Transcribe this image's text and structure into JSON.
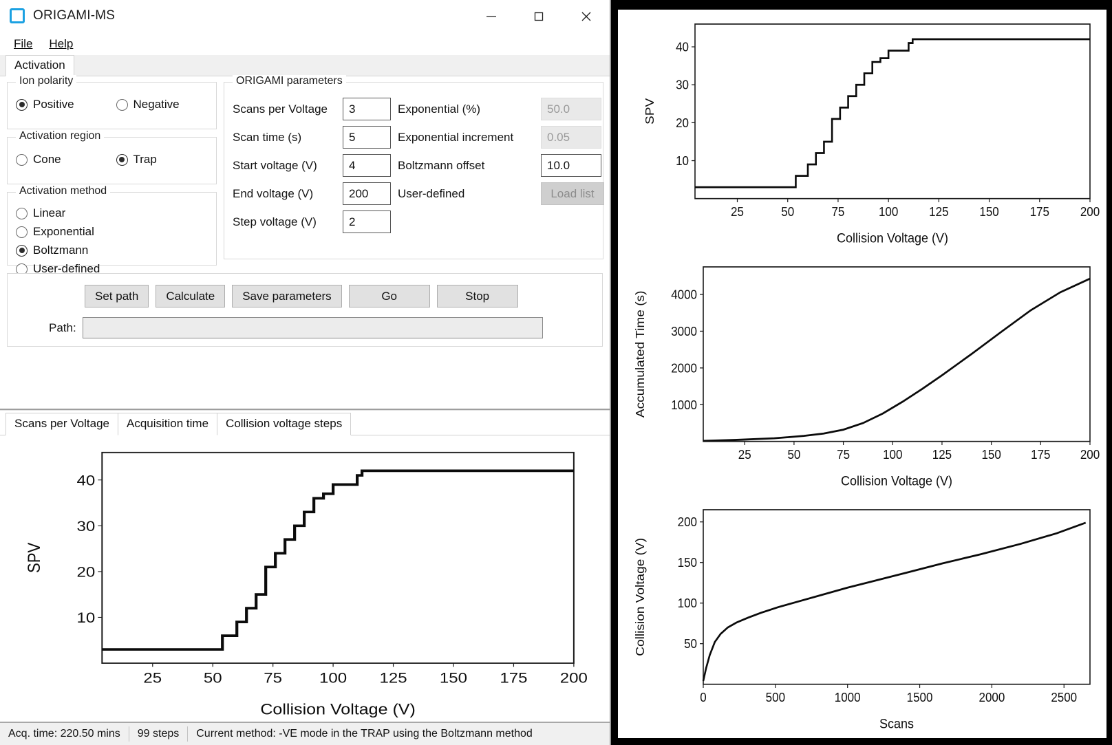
{
  "window": {
    "title": "ORIGAMI-MS",
    "icon": "app-square-icon",
    "controls": {
      "minimize": "minimize-icon",
      "maximize": "maximize-icon",
      "close": "close-icon"
    }
  },
  "menu": {
    "items": [
      "File",
      "Help"
    ]
  },
  "tabs": {
    "items": [
      "Activation"
    ],
    "active": "Activation"
  },
  "ion_polarity": {
    "title": "Ion polarity",
    "options": [
      "Positive",
      "Negative"
    ],
    "selected": "Positive"
  },
  "activation_region": {
    "title": "Activation region",
    "options": [
      "Cone",
      "Trap"
    ],
    "selected": "Trap"
  },
  "activation_method": {
    "title": "Activation method",
    "options": [
      "Linear",
      "Exponential",
      "Boltzmann",
      "User-defined"
    ],
    "selected": "Boltzmann"
  },
  "origami": {
    "title": "ORIGAMI parameters",
    "left_fields": [
      {
        "label": "Scans per Voltage",
        "value": "3",
        "enabled": true
      },
      {
        "label": "Scan time (s)",
        "value": "5",
        "enabled": true
      },
      {
        "label": "Start voltage (V)",
        "value": "4",
        "enabled": true
      },
      {
        "label": "End voltage (V)",
        "value": "200",
        "enabled": true
      },
      {
        "label": "Step voltage (V)",
        "value": "2",
        "enabled": true
      }
    ],
    "right_fields": [
      {
        "label": "Exponential (%)",
        "value": "50.0",
        "enabled": false
      },
      {
        "label": "Exponential increment",
        "value": "0.05",
        "enabled": false
      },
      {
        "label": "Boltzmann offset",
        "value": "10.0",
        "enabled": true
      },
      {
        "label": "User-defined",
        "value": "Load list",
        "enabled": false,
        "is_button": true
      }
    ]
  },
  "actions": {
    "buttons": [
      "Set path",
      "Calculate",
      "Save parameters",
      "Go",
      "Stop"
    ],
    "path_label": "Path:",
    "path_value": ""
  },
  "chart_tabs": {
    "items": [
      "Scans per Voltage",
      "Acquisition time",
      "Collision voltage steps"
    ],
    "active": "Scans per Voltage"
  },
  "statusbar": {
    "acq_time": "Acq. time: 220.50 mins",
    "steps": "99 steps",
    "method": "Current method: -VE mode in the TRAP using the Boltzmann method"
  },
  "chart_data": [
    {
      "id": "main-spv",
      "type": "line",
      "title": "",
      "xlabel": "Collision Voltage (V)",
      "ylabel": "SPV",
      "xlim": [
        4,
        200
      ],
      "ylim": [
        0,
        46
      ],
      "xticks": [
        25,
        50,
        75,
        100,
        125,
        150,
        175,
        200
      ],
      "yticks": [
        10,
        20,
        30,
        40
      ],
      "grid": false,
      "step": true,
      "x": [
        4,
        20,
        40,
        54,
        54,
        60,
        60,
        64,
        64,
        68,
        68,
        72,
        72,
        76,
        76,
        80,
        80,
        84,
        84,
        88,
        88,
        92,
        92,
        96,
        96,
        100,
        100,
        104,
        104,
        110,
        110,
        112,
        112,
        150,
        200
      ],
      "y": [
        3,
        3,
        3,
        3,
        6,
        6,
        9,
        9,
        12,
        12,
        15,
        15,
        21,
        21,
        24,
        24,
        27,
        27,
        30,
        30,
        33,
        33,
        36,
        36,
        37,
        37,
        39,
        39,
        39,
        39,
        41,
        41,
        42,
        42,
        42
      ]
    },
    {
      "id": "mini-spv",
      "type": "line",
      "title": "",
      "xlabel": "Collision Voltage (V)",
      "ylabel": "SPV",
      "xlim": [
        4,
        200
      ],
      "ylim": [
        0,
        46
      ],
      "xticks": [
        25,
        50,
        75,
        100,
        125,
        150,
        175,
        200
      ],
      "yticks": [
        10,
        20,
        30,
        40
      ],
      "grid": false,
      "step": true,
      "x": [
        4,
        20,
        40,
        54,
        54,
        60,
        60,
        64,
        64,
        68,
        68,
        72,
        72,
        76,
        76,
        80,
        80,
        84,
        84,
        88,
        88,
        92,
        92,
        96,
        96,
        100,
        100,
        104,
        104,
        110,
        110,
        112,
        112,
        150,
        200
      ],
      "y": [
        3,
        3,
        3,
        3,
        6,
        6,
        9,
        9,
        12,
        12,
        15,
        15,
        21,
        21,
        24,
        24,
        27,
        27,
        30,
        30,
        33,
        33,
        36,
        36,
        37,
        37,
        39,
        39,
        39,
        39,
        41,
        41,
        42,
        42,
        42
      ]
    },
    {
      "id": "mini-acctime",
      "type": "line",
      "title": "",
      "xlabel": "Collision Voltage (V)",
      "ylabel": "Accumulated Time (s)",
      "xlim": [
        4,
        200
      ],
      "ylim": [
        0,
        4750
      ],
      "xticks": [
        25,
        50,
        75,
        100,
        125,
        150,
        175,
        200
      ],
      "yticks": [
        1000,
        2000,
        3000,
        4000
      ],
      "grid": false,
      "step": false,
      "x": [
        4,
        20,
        40,
        55,
        65,
        75,
        85,
        95,
        105,
        115,
        125,
        140,
        155,
        170,
        185,
        200
      ],
      "y": [
        15,
        40,
        85,
        150,
        215,
        320,
        500,
        760,
        1080,
        1430,
        1800,
        2380,
        2980,
        3570,
        4060,
        4430
      ]
    },
    {
      "id": "mini-cvsteps",
      "type": "line",
      "title": "",
      "xlabel": "Scans",
      "ylabel": "Collision Voltage (V)",
      "xlim": [
        0,
        2680
      ],
      "ylim": [
        0,
        215
      ],
      "xticks": [
        0,
        500,
        1000,
        1500,
        2000,
        2500
      ],
      "yticks": [
        50,
        100,
        150,
        200
      ],
      "grid": false,
      "step": false,
      "x": [
        0,
        20,
        45,
        80,
        120,
        170,
        230,
        310,
        400,
        520,
        660,
        820,
        1000,
        1200,
        1420,
        1660,
        1920,
        2200,
        2450,
        2650
      ],
      "y": [
        4,
        20,
        36,
        52,
        62,
        70,
        76,
        82,
        88,
        95,
        102,
        110,
        119,
        128,
        138,
        149,
        160,
        173,
        186,
        199
      ]
    }
  ]
}
